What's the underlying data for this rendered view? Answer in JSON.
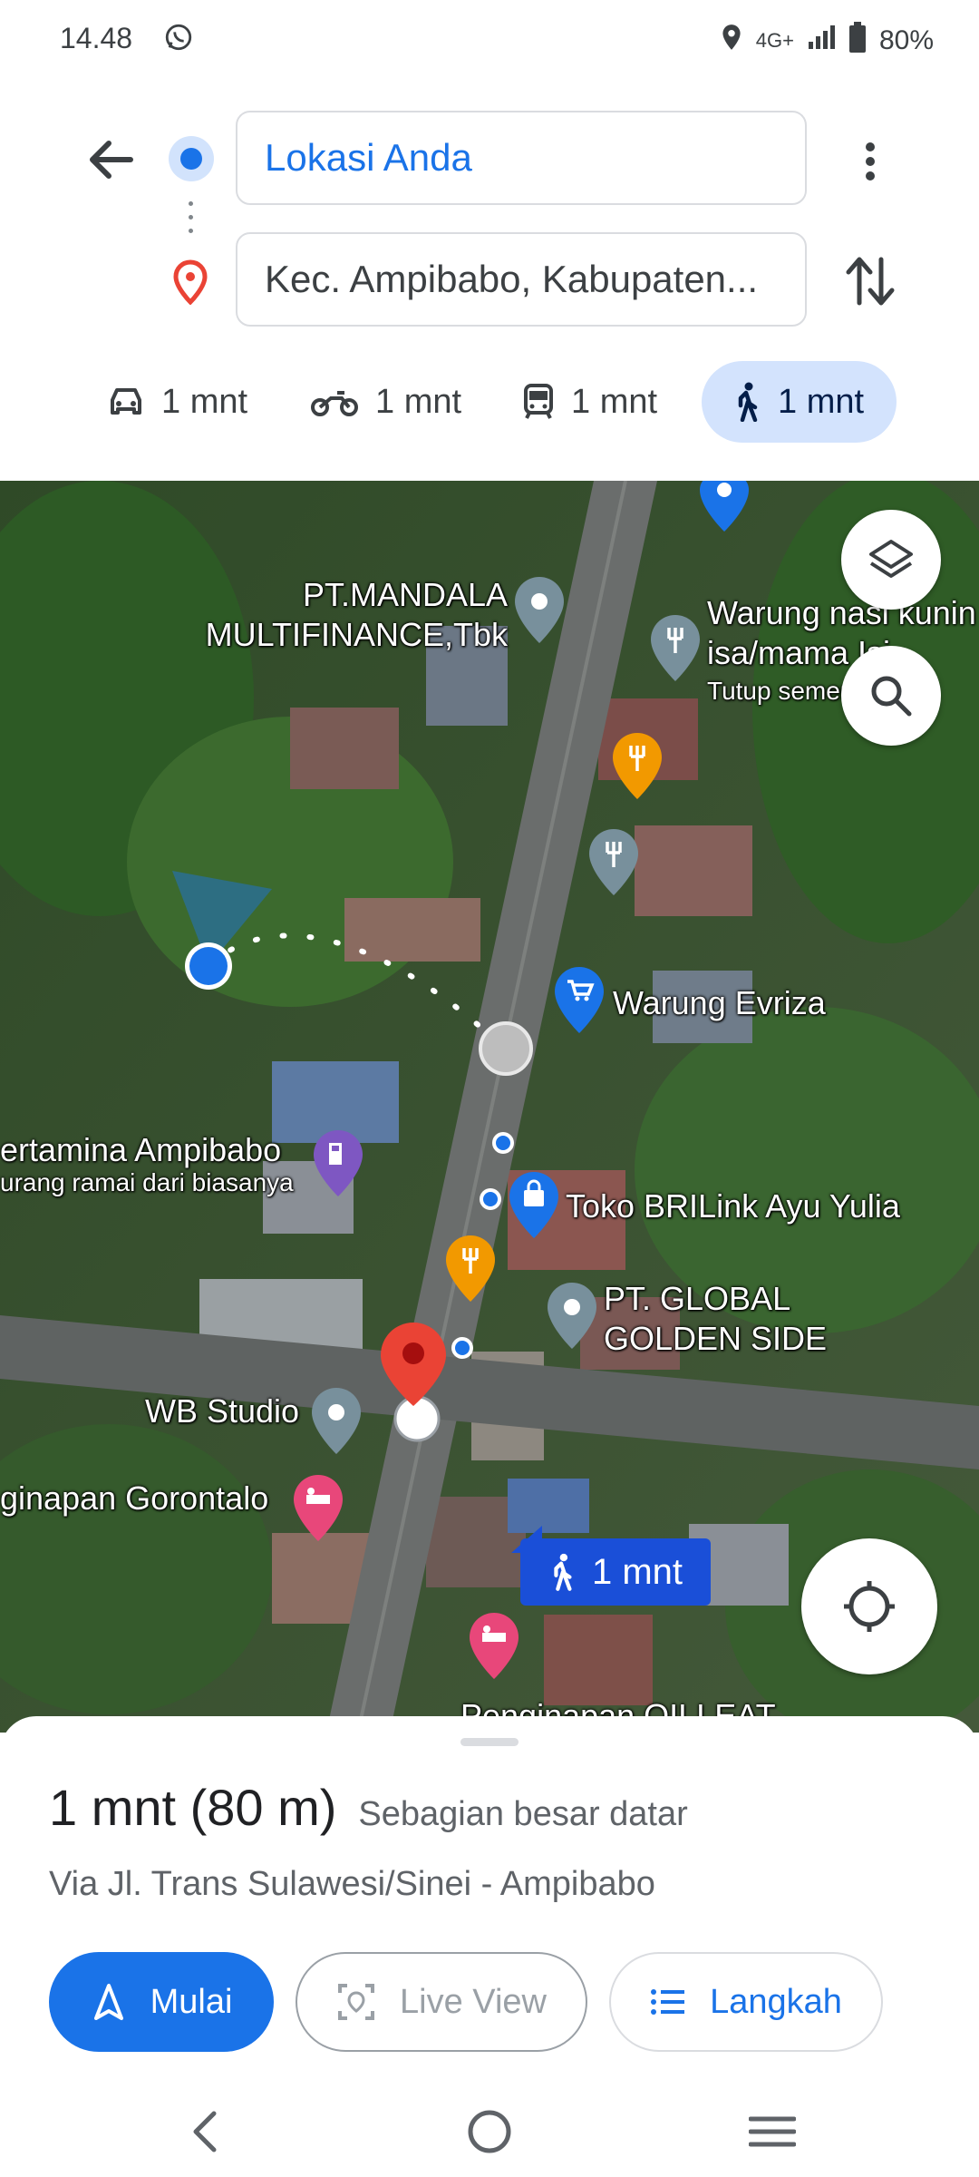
{
  "status_bar": {
    "time": "14.48",
    "network": "4G+",
    "battery": "80%",
    "icons": [
      "whatsapp-icon",
      "location-icon",
      "signal-icon",
      "battery-icon"
    ]
  },
  "search": {
    "origin_value": "Lokasi Anda",
    "destination_value": "Kec. Ampibabo, Kabupaten..."
  },
  "modes": [
    {
      "name": "car",
      "icon": "car-icon",
      "label": "1 mnt"
    },
    {
      "name": "motorcycle",
      "icon": "motorcycle-icon",
      "label": "1 mnt"
    },
    {
      "name": "transit",
      "icon": "transit-icon",
      "label": "1 mnt"
    },
    {
      "name": "walk",
      "icon": "walk-icon",
      "label": "1 mnt",
      "selected": true
    }
  ],
  "map": {
    "labels": {
      "mandala": "PT.MANDALA\nMULTIFINANCE,Tbk",
      "warung_nasi": "Warung nasi kunin\nisa/mama Isi",
      "warung_nasi_status": "Tutup sementara",
      "warung_evriza": "Warung Evriza",
      "pertamina": "ertamina Ampibabo",
      "pertamina_note": "urang ramai dari biasanya",
      "toko": "Toko BRILink Ayu Yulia",
      "global": "PT. GLOBAL\nGOLDEN SIDE",
      "wb": "WB Studio",
      "penginapan_gorontalo": "ginapan Gorontalo",
      "penginapan_bottom": "Penginapan OILLEAT"
    },
    "route_chip": "1 mnt",
    "route_color": "#1a73e8"
  },
  "sheet": {
    "summary_time": "1 mnt (80 m)",
    "summary_note": "Sebagian besar datar",
    "via": "Via Jl. Trans Sulawesi/Sinei - Ampibabo",
    "start_label": "Mulai",
    "live_view_label": "Live View",
    "steps_label": "Langkah"
  },
  "colors": {
    "accent": "#1a73e8",
    "active_mode_bg": "#d3e3fd",
    "destination_pin": "#ea4335"
  }
}
